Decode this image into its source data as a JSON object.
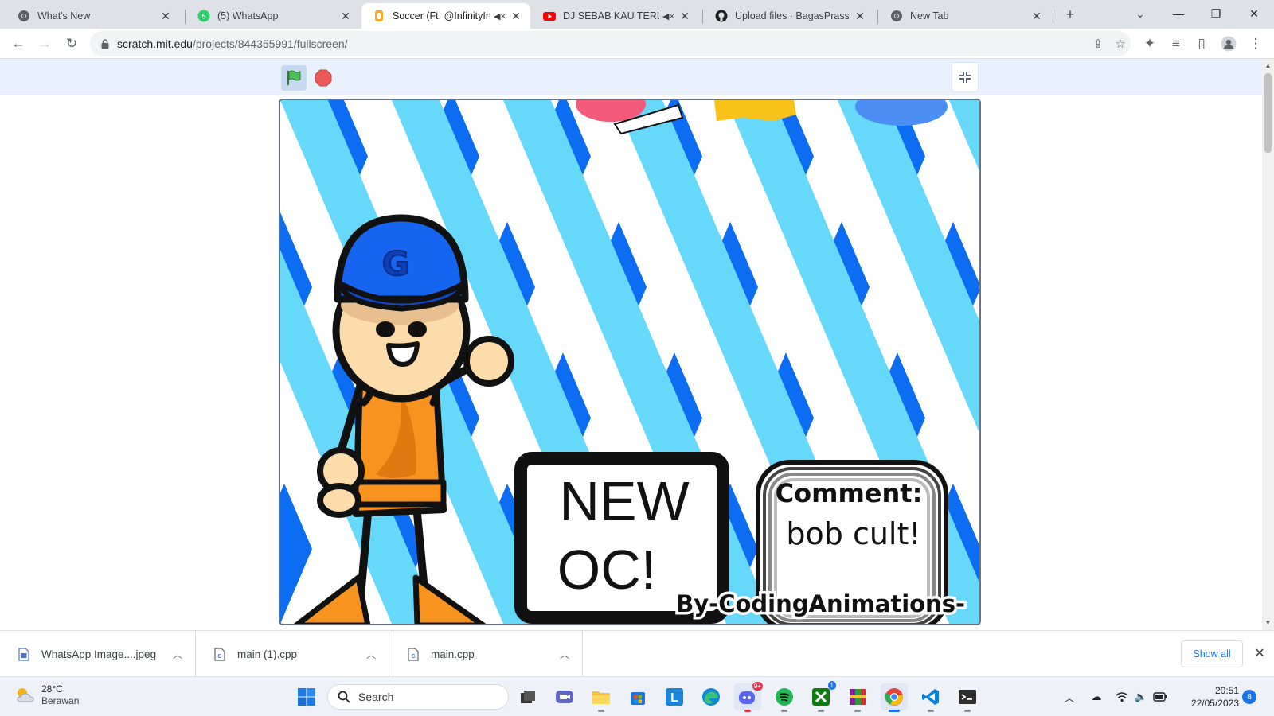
{
  "browser": {
    "tabs": [
      {
        "title": "What's New",
        "icon": "chrome-icon",
        "active": false,
        "muted": false
      },
      {
        "title": "(5) WhatsApp",
        "icon": "whatsapp-icon",
        "active": false,
        "muted": false
      },
      {
        "title": "Soccer (Ft. @InfinityIns",
        "icon": "scratch-icon",
        "active": true,
        "muted": true
      },
      {
        "title": "DJ SEBAB KAU TERLALU",
        "icon": "youtube-icon",
        "active": false,
        "muted": true
      },
      {
        "title": "Upload files · BagasPrass/A",
        "icon": "github-icon",
        "active": false,
        "muted": false
      },
      {
        "title": "New Tab",
        "icon": "chrome-icon",
        "active": false,
        "muted": false
      }
    ],
    "address": {
      "host": "scratch.mit.edu",
      "path": "/projects/844355991/fullscreen/"
    }
  },
  "stage": {
    "sign_line1": "NEW",
    "sign_line2": "OC!",
    "comment_label": "Comment:",
    "comment_text": "bob cult!",
    "credit": "By-CodingAnimations-",
    "cap_letter": "G",
    "colors": {
      "dark_blue": "#0c6cf2",
      "light_blue": "#66d9fa",
      "skin": "#fcdcab",
      "shirt": "#f7931e",
      "cap": "#1565f0"
    }
  },
  "downloads": {
    "items": [
      {
        "name": "WhatsApp Image....jpeg"
      },
      {
        "name": "main (1).cpp"
      },
      {
        "name": "main.cpp"
      }
    ],
    "show_all": "Show all"
  },
  "taskbar": {
    "weather_temp": "28°C",
    "weather_cond": "Berawan",
    "search_label": "Search",
    "chat_badge": "9+",
    "xbox_badge": "1",
    "time": "20:51",
    "date": "22/05/2023",
    "notification_count": "8"
  }
}
